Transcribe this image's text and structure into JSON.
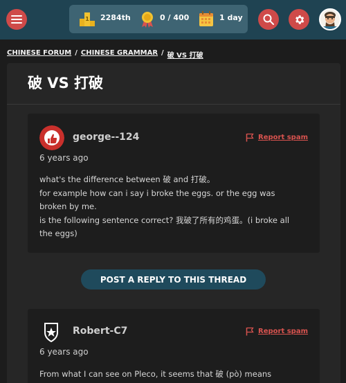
{
  "header": {
    "icons": [
      "menu-icon",
      "trophy-icon",
      "medal-icon",
      "calendar-icon",
      "search-icon",
      "gear-icon"
    ],
    "stats": {
      "points": "2284th",
      "score": "0 / 400",
      "streak": "1 day"
    },
    "colors": {
      "bar": "#1f4352",
      "stats_panel": "#3e6473",
      "button": "#cf4a49"
    }
  },
  "breadcrumb": {
    "items": [
      "CHINESE FORUM",
      "CHINESE GRAMMAR",
      "破 VS 打破"
    ],
    "separator": "/"
  },
  "thread": {
    "title": "破 VS 打破",
    "reply_label": "POST A REPLY TO THIS THREAD",
    "posts": [
      {
        "author": "george--124",
        "time": "6 years ago",
        "report_label": "Report spam",
        "lines": [
          "what's the difference between 破 and 打破。",
          "for example how can i say i broke the eggs. or the egg was",
          "broken by me.",
          "is the following sentence correct? 我破了所有的鸡蛋。(i broke all",
          "the eggs)"
        ]
      },
      {
        "author": "Robert-C7",
        "time": "6 years ago",
        "report_label": "Report spam",
        "lines": [
          "From what I can see on Pleco, it seems that 破 (pò) means"
        ]
      }
    ]
  }
}
